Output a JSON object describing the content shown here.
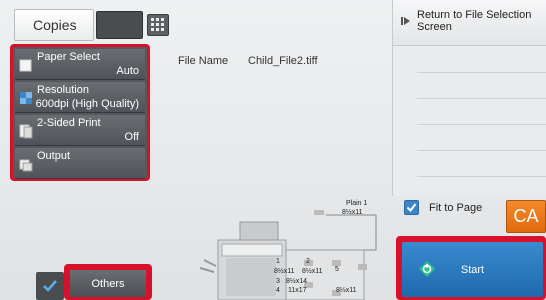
{
  "header": {
    "copies_label": "Copies"
  },
  "panel": {
    "items": [
      {
        "label": "Paper Select",
        "value": "Auto",
        "icon": "paper-select-icon"
      },
      {
        "label": "Resolution",
        "value": "600dpi (High Quality)",
        "icon": "resolution-icon"
      },
      {
        "label": "2-Sided Print",
        "value": "Off",
        "icon": "duplex-icon"
      },
      {
        "label": "Output",
        "value": "",
        "icon": "output-icon"
      }
    ]
  },
  "file": {
    "name_label": "File Name",
    "name_value": "Child_File2.tiff"
  },
  "right": {
    "return_label": "Return to File Selection Screen"
  },
  "fit": {
    "label": "Fit to Page",
    "checked": true
  },
  "ca": {
    "label": "CA"
  },
  "start": {
    "label": "Start"
  },
  "others": {
    "label": "Others"
  },
  "machine": {
    "top_tray": "Plain 1",
    "top_tray_size": "8½x11",
    "tray1": "1",
    "tray2": "2",
    "tray1_size": "8½x11",
    "tray2_size": "8½x11",
    "tray3": "3",
    "tray3_size": "8½x14",
    "tray4": "4",
    "tray4_size": "11x17",
    "tray5": "5",
    "tray5_size": "8½x11"
  },
  "colors": {
    "highlight": "#d8112b",
    "start": "#2a78bf",
    "ca": "#ea7a1a"
  }
}
